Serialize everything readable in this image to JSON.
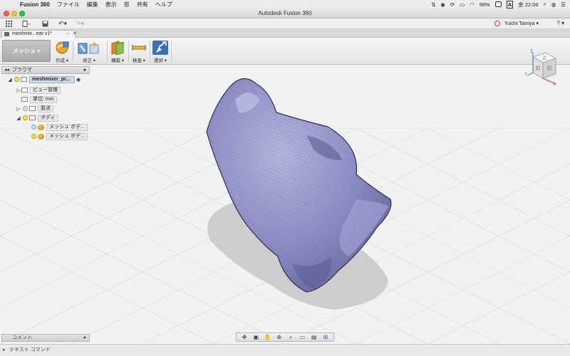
{
  "menubar": {
    "app_name": "Fusion 360",
    "items": [
      "ファイル",
      "編集",
      "表示",
      "窓",
      "共有",
      "ヘルプ"
    ],
    "battery": "98%",
    "input_source": "A",
    "clock": "金 22:06"
  },
  "window": {
    "title": "Autodesk Fusion 360"
  },
  "qat": {
    "user": "Yuichi Tamiya ▾",
    "help": "? ▾"
  },
  "tab": {
    "label": "meshmix...ear v1*"
  },
  "ribbon": {
    "workspace": "メッシュ ▾",
    "groups": [
      "作成 ▾",
      "修正 ▾",
      "構築 ▾",
      "検査 ▾",
      "選択 ▾"
    ]
  },
  "browser": {
    "title": "ブラウザ",
    "root": "meshmixer_pr...",
    "nodes": [
      "ビュー管理",
      "単位: mm",
      "原点",
      "ボディ"
    ],
    "bodies": [
      "メッシュ ボデ...",
      "メッシュ ボデ..."
    ]
  },
  "viewcube": {
    "top": "上",
    "front": "前",
    "right": "右",
    "axis_z": "Z",
    "axis_x": "X",
    "axis_y": "Y"
  },
  "bottom": {
    "comments": "コメント",
    "text_command": "テキスト コマンド"
  },
  "colors": {
    "mesh": "#8d8ec5",
    "accent": "#3b6fb5"
  },
  "navbar_icons": [
    "orbit-icon",
    "look-at-icon",
    "pan-icon",
    "zoom-icon",
    "fit-icon",
    "display-settings-icon",
    "grid-icon",
    "viewports-icon"
  ]
}
